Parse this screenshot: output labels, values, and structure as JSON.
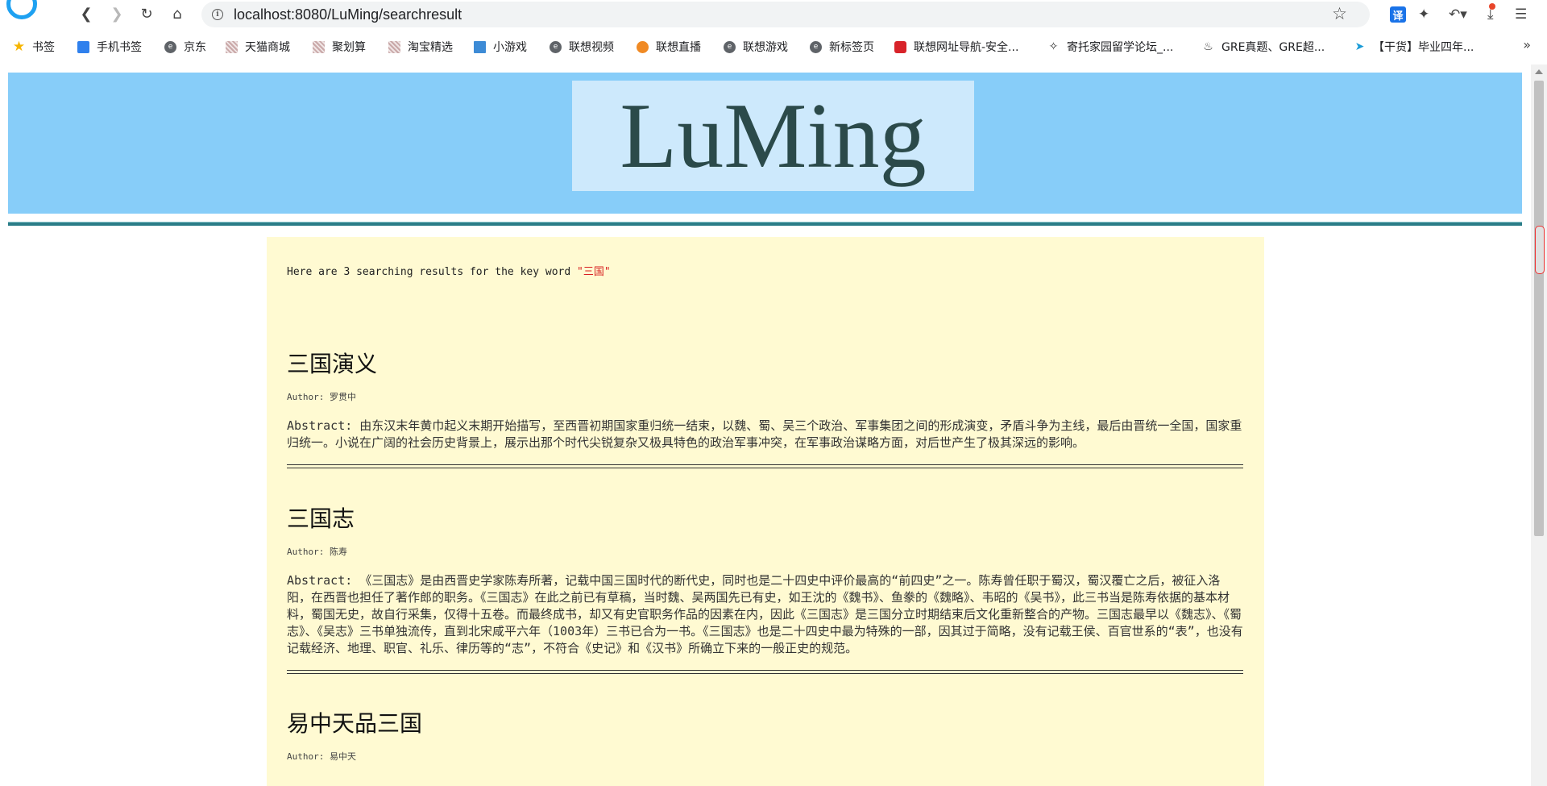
{
  "browser": {
    "url": "localhost:8080/LuMing/searchresult",
    "translate_label": "译"
  },
  "bookmarks": [
    {
      "label": "书签",
      "icon": "star-icon"
    },
    {
      "label": "手机书签",
      "icon": "phone-icon"
    },
    {
      "label": "京东",
      "icon": "e-icon"
    },
    {
      "label": "天猫商城",
      "icon": "grid-icon"
    },
    {
      "label": "聚划算",
      "icon": "grid-icon"
    },
    {
      "label": "淘宝精选",
      "icon": "grid-icon"
    },
    {
      "label": "小游戏",
      "icon": "game-icon"
    },
    {
      "label": "联想视频",
      "icon": "e-icon"
    },
    {
      "label": "联想直播",
      "icon": "live-icon"
    },
    {
      "label": "联想游戏",
      "icon": "e-icon"
    },
    {
      "label": "新标签页",
      "icon": "e-icon"
    },
    {
      "label": "联想网址导航-安全...",
      "icon": "red-icon"
    },
    {
      "label": "寄托家园留学论坛_...",
      "icon": "gt-icon"
    },
    {
      "label": "GRE真题、GRE超...",
      "icon": "mono-icon"
    },
    {
      "label": "【干货】毕业四年...",
      "icon": "bird-icon"
    }
  ],
  "site": {
    "logo": "LuMing"
  },
  "search": {
    "summary_prefix": "Here are 3 searching results for the key word ",
    "keyword": "\"三国\""
  },
  "results": [
    {
      "title": "三国演义",
      "author": "Author: 罗贯中",
      "abstract": "Abstract: 由东汉末年黄巾起义末期开始描写，至西晋初期国家重归统一结束，以魏、蜀、吴三个政治、军事集团之间的形成演变，矛盾斗争为主线，最后由晋统一全国，国家重归统一。小说在广阔的社会历史背景上，展示出那个时代尖锐复杂又极具特色的政治军事冲突，在军事政治谋略方面，对后世产生了极其深远的影响。"
    },
    {
      "title": "三国志",
      "author": "Author: 陈寿",
      "abstract": "Abstract: 《三国志》是由西晋史学家陈寿所著，记载中国三国时代的断代史，同时也是二十四史中评价最高的“前四史”之一。陈寿曾任职于蜀汉，蜀汉覆亡之后，被征入洛阳，在西晋也担任了著作郎的职务。《三国志》在此之前已有草稿，当时魏、吴两国先已有史，如王沈的《魏书》、鱼豢的《魏略》、韦昭的《吴书》，此三书当是陈寿依据的基本材料，蜀国无史，故自行采集，仅得十五卷。而最终成书，却又有史官职务作品的因素在内，因此《三国志》是三国分立时期结束后文化重新整合的产物。三国志最早以《魏志》、《蜀志》、《吴志》三书单独流传，直到北宋咸平六年（1003年）三书已合为一书。《三国志》也是二十四史中最为特殊的一部，因其过于简略，没有记载王侯、百官世系的“表”，也没有记载经济、地理、职官、礼乐、律历等的“志”，不符合《史记》和《汉书》所确立下来的一般正史的规范。"
    },
    {
      "title": "易中天品三国",
      "author": "Author: 易中天",
      "abstract": ""
    }
  ]
}
